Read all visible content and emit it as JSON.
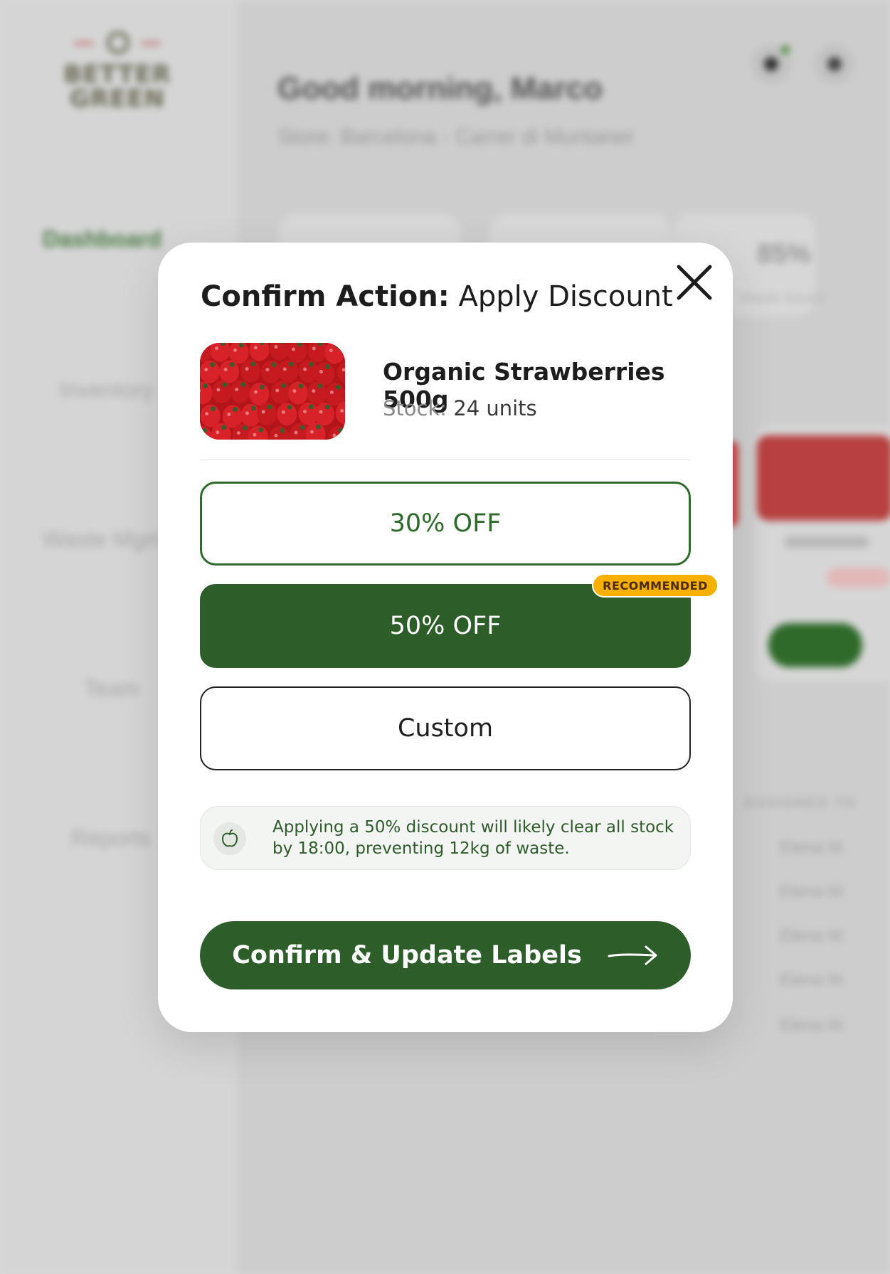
{
  "background": {
    "logo_text": "BETTER\nGREEN",
    "greeting": "Good morning, Marco",
    "store": "Store: Barcelona - Carrer di Muntaner",
    "nav": [
      "Dashboard",
      "Inventory",
      "Waste Mgmt",
      "Team",
      "Reports"
    ],
    "stat_value": "85%",
    "stat_sub": "Waste Saved",
    "assigned_header": "ASSIGNED TO",
    "assigned_rows": [
      "Elena M.",
      "Elena M.",
      "Elena M.",
      "Elena M.",
      "Elena M."
    ]
  },
  "modal": {
    "title_strong": "Confirm Action:",
    "title_light": "Apply Discount",
    "product": {
      "name": "Organic Strawberries 500g",
      "stock_label": "Stock:",
      "stock_value": "24 units"
    },
    "options": {
      "opt30": "30% OFF",
      "opt50": "50% OFF",
      "custom": "Custom",
      "recommended_badge": "RECOMMENDED"
    },
    "info": "Applying a 50% discount will likely clear all stock by 18:00, preventing 12kg of waste.",
    "confirm_label": "Confirm & Update Labels"
  },
  "icons": {
    "close": "close-icon",
    "info": "apple-icon",
    "confirm": "arrow-right-icon"
  },
  "colors": {
    "primary_green": "#2d5e2a",
    "badge_yellow": "#f5b000"
  }
}
